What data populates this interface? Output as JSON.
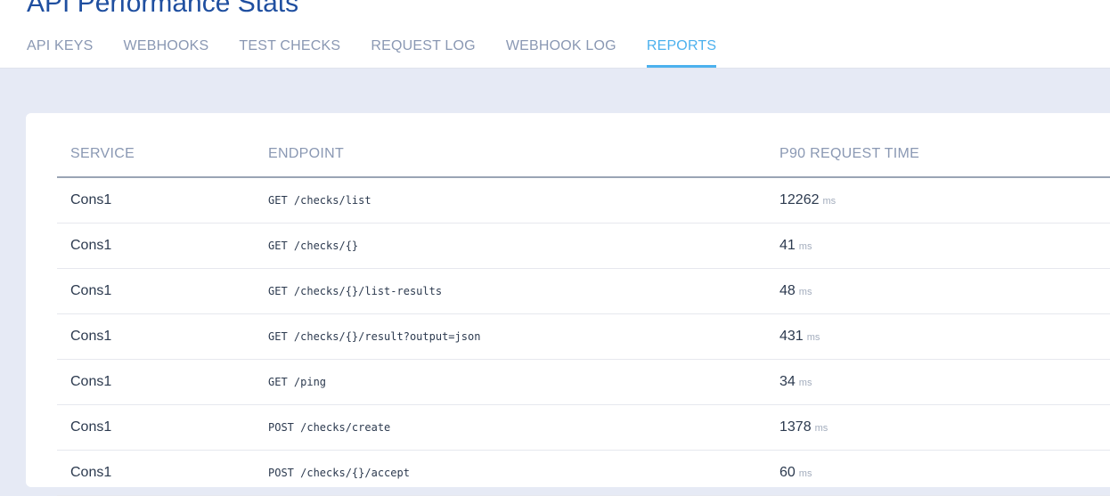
{
  "page_title": "API Performance Stats",
  "tabs": [
    {
      "label": "API KEYS"
    },
    {
      "label": "WEBHOOKS"
    },
    {
      "label": "TEST CHECKS"
    },
    {
      "label": "REQUEST LOG"
    },
    {
      "label": "WEBHOOK LOG"
    },
    {
      "label": "REPORTS",
      "active": true
    }
  ],
  "table": {
    "headers": {
      "service": "SERVICE",
      "endpoint": "ENDPOINT",
      "time": "P90 REQUEST TIME"
    },
    "rows": [
      {
        "service": "Cons1",
        "endpoint": "GET /checks/list",
        "time": "12262",
        "unit": "ms"
      },
      {
        "service": "Cons1",
        "endpoint": "GET /checks/{}",
        "time": "41",
        "unit": "ms"
      },
      {
        "service": "Cons1",
        "endpoint": "GET /checks/{}/list-results",
        "time": "48",
        "unit": "ms"
      },
      {
        "service": "Cons1",
        "endpoint": "GET /checks/{}/result?output=json",
        "time": "431",
        "unit": "ms"
      },
      {
        "service": "Cons1",
        "endpoint": "GET /ping",
        "time": "34",
        "unit": "ms"
      },
      {
        "service": "Cons1",
        "endpoint": "POST /checks/create",
        "time": "1378",
        "unit": "ms"
      },
      {
        "service": "Cons1",
        "endpoint": "POST /checks/{}/accept",
        "time": "60",
        "unit": "ms"
      }
    ]
  }
}
